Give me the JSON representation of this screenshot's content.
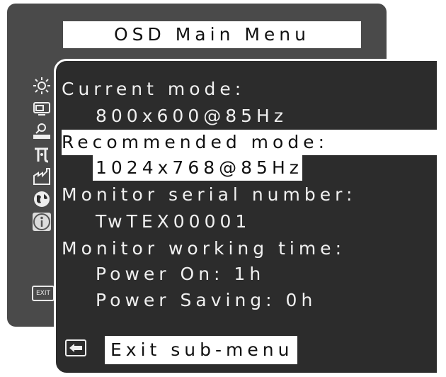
{
  "window": {
    "title": "OSD Main Menu"
  },
  "sidebar": {
    "items": [
      {
        "icon": "brightness-icon",
        "selected": false
      },
      {
        "icon": "display-size-icon",
        "selected": false
      },
      {
        "icon": "adjust-icon",
        "selected": false
      },
      {
        "icon": "color-icon",
        "selected": false
      },
      {
        "icon": "factory-icon",
        "selected": false
      },
      {
        "icon": "language-globe-icon",
        "selected": false
      },
      {
        "icon": "information-icon",
        "selected": true
      }
    ],
    "exit_label": "EXIT"
  },
  "info": {
    "current_mode_label": "Current mode:",
    "current_mode_value": "800x600@85Hz",
    "recommended_mode_label": "Recommended mode:",
    "recommended_mode_value": "1024x768@85Hz",
    "serial_label": "Monitor serial number:",
    "serial_value": "TwTEX00001",
    "working_time_label": "Monitor working time:",
    "power_on": "Power On: 1h",
    "power_saving": "Power Saving: 0h"
  },
  "footer": {
    "exit_submenu_label": "Exit sub-menu"
  },
  "colors": {
    "frame": "#4a4a4a",
    "panel": "#2c2c2c",
    "highlight": "#ffffff",
    "text": "#f0f0f0"
  }
}
